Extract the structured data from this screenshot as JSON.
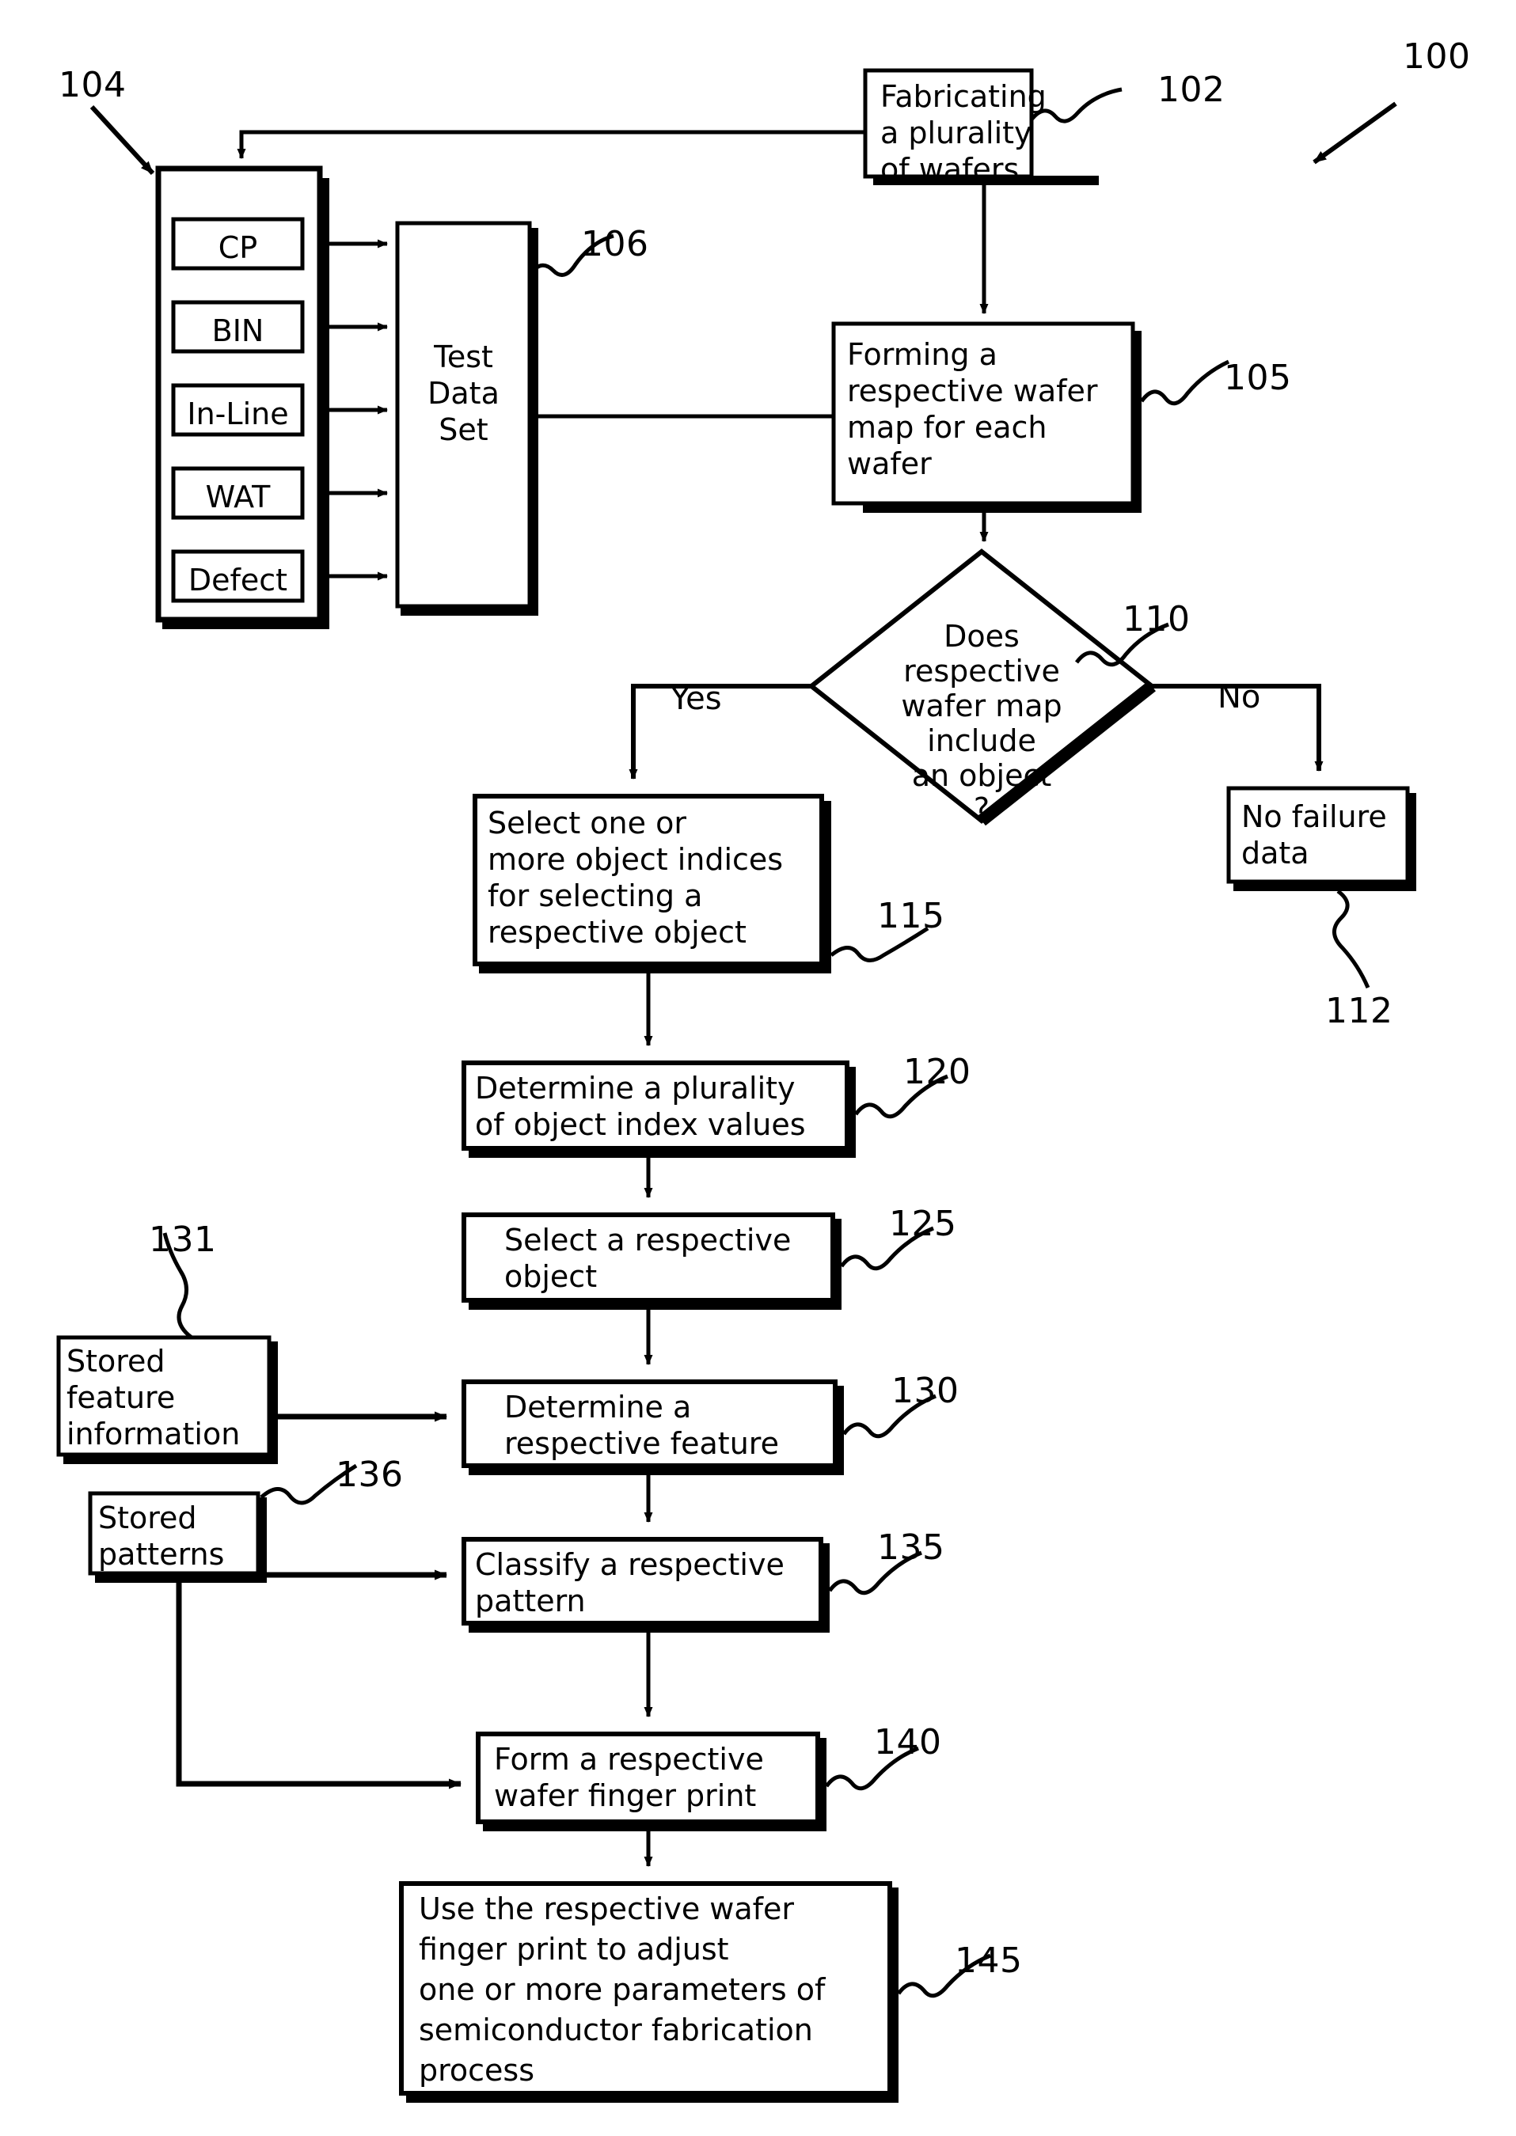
{
  "figure": {
    "number": "100",
    "type": "process-flowchart"
  },
  "nodes": {
    "fabricating": {
      "ref": "102",
      "lines": [
        "Fabricating",
        "a plurality",
        "of wafers"
      ]
    },
    "data_sources_container": {
      "ref": "104",
      "items": [
        {
          "label": "CP"
        },
        {
          "label": "BIN"
        },
        {
          "label": "In-Line"
        },
        {
          "label": "WAT"
        },
        {
          "label": "Defect"
        }
      ]
    },
    "test_data_set": {
      "ref": "106",
      "lines": [
        "Test",
        "Data",
        "Set"
      ]
    },
    "forming_wafer_map": {
      "ref": "105",
      "lines": [
        "Forming a",
        "respective wafer",
        "map for each",
        "wafer"
      ]
    },
    "decision_object": {
      "ref": "110",
      "lines": [
        "Does",
        "respective",
        "wafer map",
        "include",
        "an object",
        "?"
      ],
      "yes_label": "Yes",
      "no_label": "No"
    },
    "no_failure_data": {
      "ref": "112",
      "lines": [
        "No failure",
        "data"
      ]
    },
    "select_object_indices": {
      "ref": "115",
      "lines": [
        "Select one or",
        "more object indices",
        "for selecting a",
        "respective object"
      ]
    },
    "determine_index_values": {
      "ref": "120",
      "lines": [
        "Determine a plurality",
        "of object index values"
      ]
    },
    "select_respective_object": {
      "ref": "125",
      "lines": [
        "Select a respective",
        "object"
      ]
    },
    "stored_feature_information": {
      "ref": "131",
      "lines": [
        "Stored",
        "feature",
        "information"
      ]
    },
    "determine_feature": {
      "ref": "130",
      "lines": [
        "Determine a",
        "respective feature"
      ]
    },
    "stored_patterns": {
      "ref": "136",
      "lines": [
        "Stored",
        "patterns"
      ]
    },
    "classify_pattern": {
      "ref": "135",
      "lines": [
        "Classify a respective",
        "pattern"
      ]
    },
    "form_finger_print": {
      "ref": "140",
      "lines": [
        "Form a respective",
        "wafer finger print"
      ]
    },
    "use_finger_print": {
      "ref": "145",
      "lines": [
        "Use the respective wafer",
        "finger print to adjust",
        "one or more parameters of",
        "semiconductor fabrication",
        "process"
      ]
    }
  },
  "colors": {
    "stroke": "#000000",
    "fill": "#ffffff",
    "text": "#000000"
  }
}
